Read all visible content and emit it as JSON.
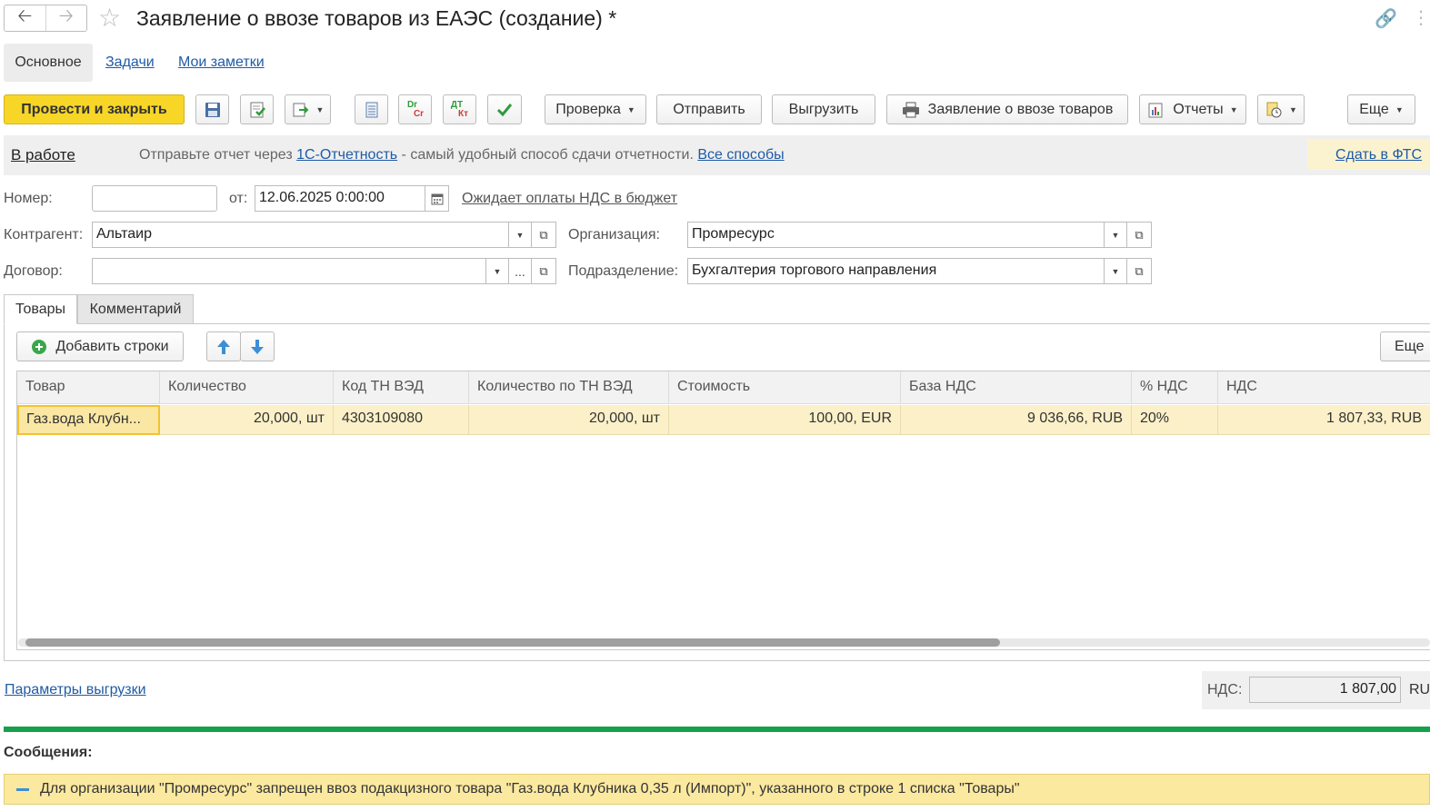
{
  "window": {
    "title": "Заявление о ввозе товаров из ЕАЭС (создание) *"
  },
  "subtabs": {
    "main": "Основное",
    "tasks": "Задачи",
    "notes": "Мои заметки"
  },
  "toolbar": {
    "post_close": "Провести и закрыть",
    "check": "Проверка",
    "send": "Отправить",
    "export": "Выгрузить",
    "print_statement": "Заявление о ввозе товаров",
    "reports": "Отчеты",
    "more": "Еще",
    "dr_cr_top": "Dr",
    "dr_cr_bottom": "Cr",
    "dt_kt_top": "ДТ",
    "dt_kt_bottom": "Кт"
  },
  "infobar": {
    "status": "В работе",
    "text_before": "Отправьте отчет через ",
    "link_1c": "1С-Отчетность",
    "text_after": " - самый удобный способ сдачи отчетности. ",
    "all_ways": "Все способы",
    "send_fts": "Сдать в ФТС"
  },
  "form": {
    "number_label": "Номер:",
    "number_value": "",
    "date_label": "от:",
    "date_value": "12.06.2025  0:00:00",
    "vat_status_link": "Ожидает оплаты НДС в бюджет",
    "counterparty_label": "Контрагент:",
    "counterparty_value": "Альтаир",
    "organization_label": "Организация:",
    "organization_value": "Промресурс",
    "contract_label": "Договор:",
    "contract_value": "",
    "division_label": "Подразделение:",
    "division_value": "Бухгалтерия торгового направления"
  },
  "tabs": {
    "goods": "Товары",
    "comment": "Комментарий"
  },
  "goods_toolbar": {
    "add_rows": "Добавить строки",
    "more": "Еще"
  },
  "table": {
    "columns": [
      "Товар",
      "Количество",
      "Код ТН ВЭД",
      "Количество по ТН ВЭД",
      "Стоимость",
      "База НДС",
      "% НДС",
      "НДС"
    ],
    "rows": [
      [
        "Газ.вода Клубн...",
        "20,000, шт",
        "4303109080",
        "20,000, шт",
        "100,00, EUR",
        "9 036,66, RUB",
        "20%",
        "1 807,33, RUB"
      ]
    ]
  },
  "footer": {
    "export_params": "Параметры выгрузки",
    "nds_label": "НДС:",
    "nds_value": "1 807,00",
    "nds_currency": "RU",
    "messages_title": "Сообщения:",
    "message": "Для организации \"Промресурс\" запрещен ввоз подакцизного товара \"Газ.вода Клубника 0,35 л (Импорт)\", указанного в строке 1 списка \"Товары\""
  },
  "colors": {
    "primary_button": "#f7d627",
    "link": "#1f5ba6",
    "selected_row": "#fbf0c8",
    "green_line": "#17a04b",
    "message_bar": "#fbe9a0"
  }
}
